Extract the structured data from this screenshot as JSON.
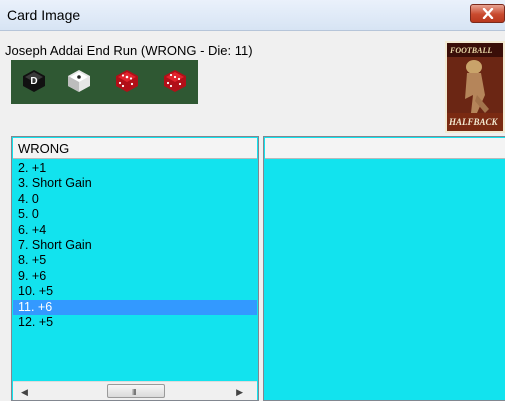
{
  "window": {
    "title": "Card Image"
  },
  "play": {
    "description": "Joseph Addai End Run (WRONG - Die: 11)"
  },
  "dice": [
    {
      "icon": "black-d-die-icon",
      "face": "D",
      "color": "#111111"
    },
    {
      "icon": "white-die-icon",
      "face": "1",
      "color": "#f2f2f2"
    },
    {
      "icon": "red-die-icon",
      "face": "5",
      "color": "#c8121c"
    },
    {
      "icon": "red-die-icon",
      "face": "6",
      "color": "#c8121c"
    }
  ],
  "card": {
    "top_text": "FOOTBALL",
    "bottom_text": "HALFBACK"
  },
  "results_list": {
    "header": "WRONG",
    "selected_index": 9,
    "items": [
      "2. +1",
      "3. Short Gain",
      "4. 0",
      "5. 0",
      "6. +4",
      "7. Short Gain",
      "8. +5",
      "9. +6",
      "10. +5",
      "11. +6",
      "12. +5"
    ],
    "scroll_thumb_grip": "III"
  },
  "colors": {
    "panel_bg": "#12e3ee",
    "selection": "#3399ff",
    "dice_bg": "#2f5833"
  }
}
